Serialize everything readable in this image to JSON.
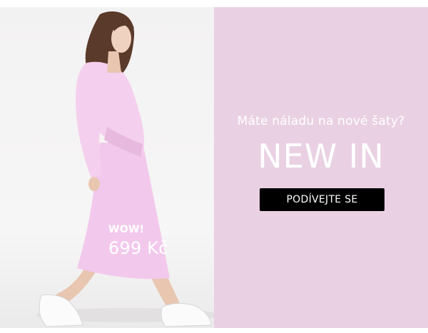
{
  "banner": {
    "photo": {
      "badge_label": "WOW!",
      "price": "699 Kč"
    },
    "promo": {
      "subtitle": "Máte náladu na nové šaty?",
      "headline": "NEW IN",
      "cta_label": "PODÍVEJTE SE",
      "background_color": "#e9d1e3",
      "cta_color": "#000000"
    }
  }
}
